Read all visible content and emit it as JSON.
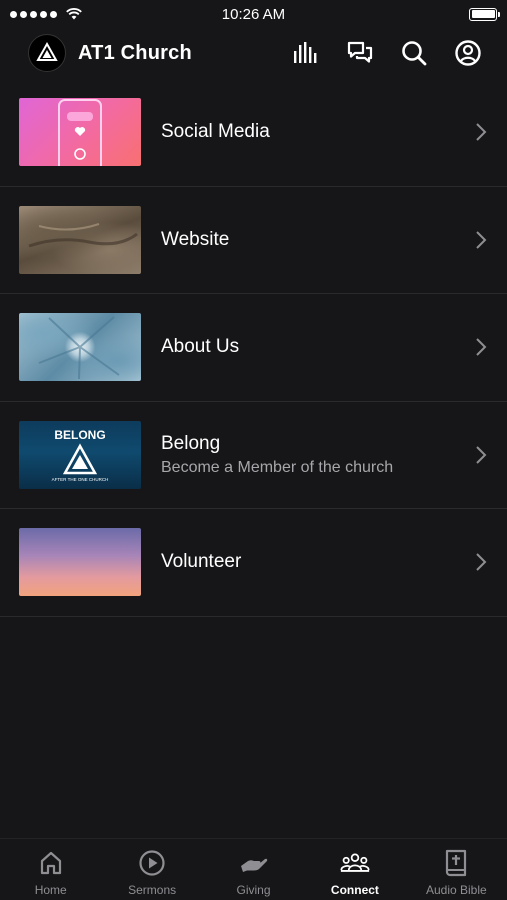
{
  "status_bar": {
    "time": "10:26 AM"
  },
  "header": {
    "title": "AT1 Church"
  },
  "list": {
    "items": [
      {
        "title": "Social Media",
        "subtitle": ""
      },
      {
        "title": "Website",
        "subtitle": ""
      },
      {
        "title": "About Us",
        "subtitle": ""
      },
      {
        "title": "Belong",
        "subtitle": "Become a Member of the church",
        "thumb_text": "BELONG",
        "thumb_caption": "AFTER THE ONE CHURCH"
      },
      {
        "title": "Volunteer",
        "subtitle": ""
      }
    ]
  },
  "tabs": [
    {
      "label": "Home",
      "icon": "home-icon",
      "active": false
    },
    {
      "label": "Sermons",
      "icon": "play-circle-icon",
      "active": false
    },
    {
      "label": "Giving",
      "icon": "giving-hand-icon",
      "active": false
    },
    {
      "label": "Connect",
      "icon": "people-icon",
      "active": true
    },
    {
      "label": "Audio Bible",
      "icon": "bible-icon",
      "active": false
    }
  ],
  "colors": {
    "background": "#161618",
    "text_primary": "#ffffff",
    "text_secondary": "#a7a7ab",
    "tab_inactive": "#8e8e93",
    "divider": "#2a2a2d"
  }
}
